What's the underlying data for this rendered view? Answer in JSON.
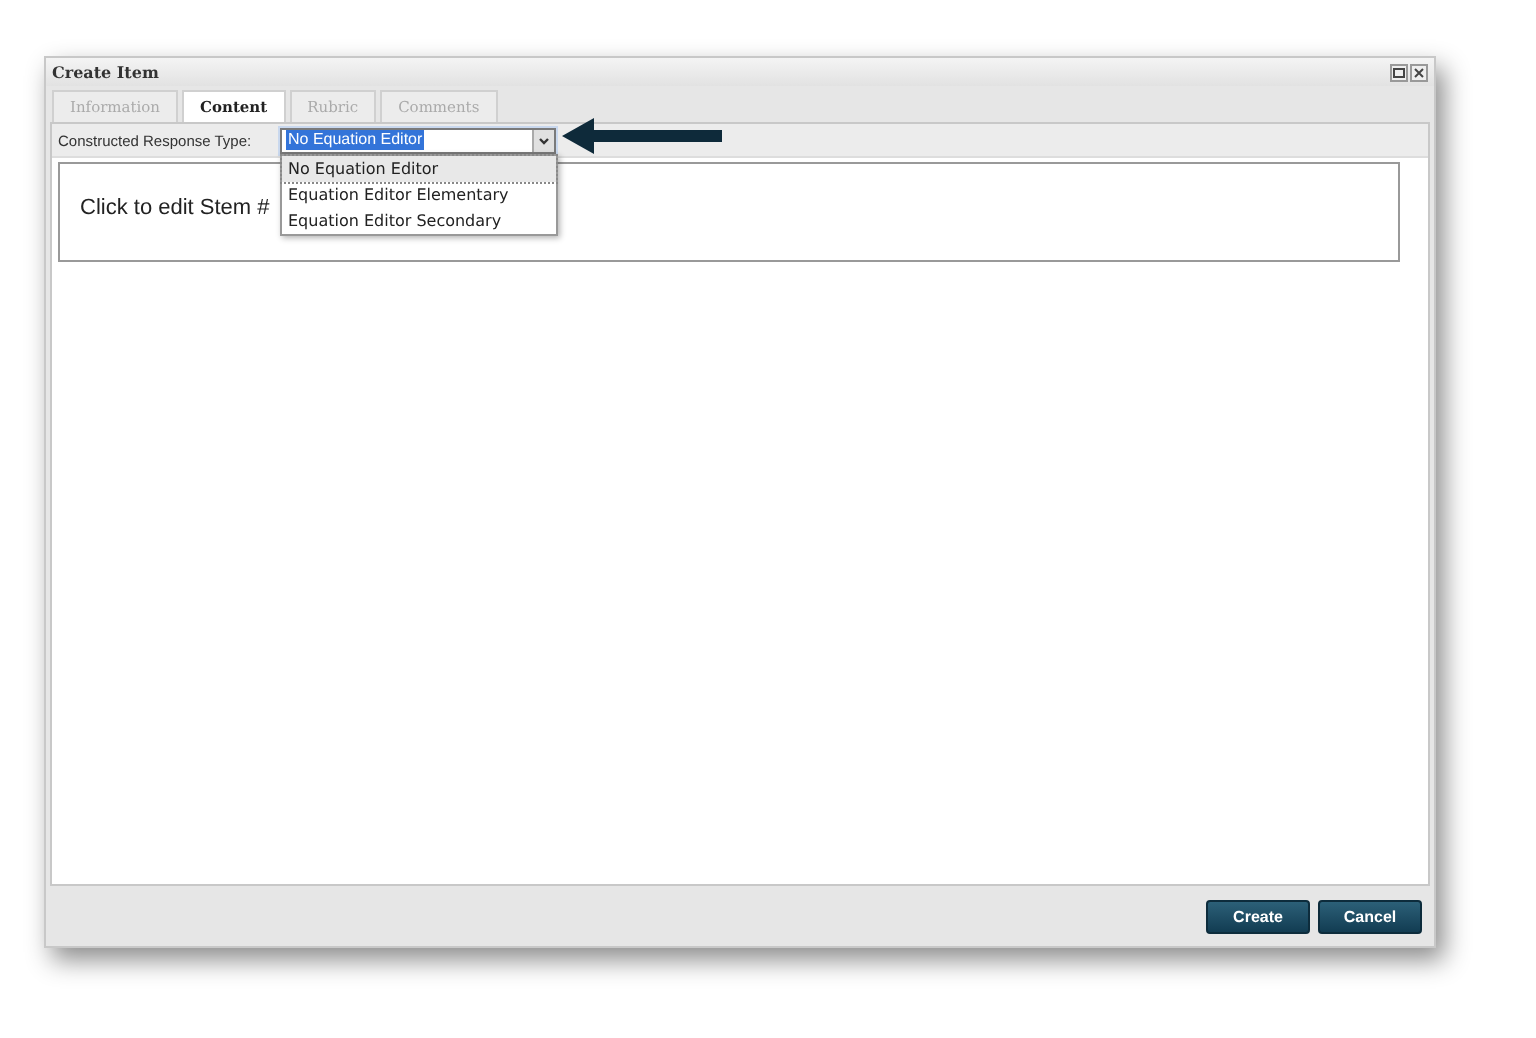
{
  "window": {
    "title": "Create Item"
  },
  "tabs": [
    {
      "label": "Information",
      "selected": false
    },
    {
      "label": "Content",
      "selected": true
    },
    {
      "label": "Rubric",
      "selected": false
    },
    {
      "label": "Comments",
      "selected": false
    }
  ],
  "response_type": {
    "label": "Constructed Response Type:",
    "value": "No Equation Editor",
    "expanded": true,
    "options": [
      {
        "label": "No Equation Editor",
        "selected": true
      },
      {
        "label": "Equation Editor Elementary",
        "selected": false
      },
      {
        "label": "Equation Editor Secondary",
        "selected": false
      }
    ]
  },
  "stem": {
    "text": "Click to edit Stem #"
  },
  "buttons": [
    "Create",
    "Cancel"
  ]
}
